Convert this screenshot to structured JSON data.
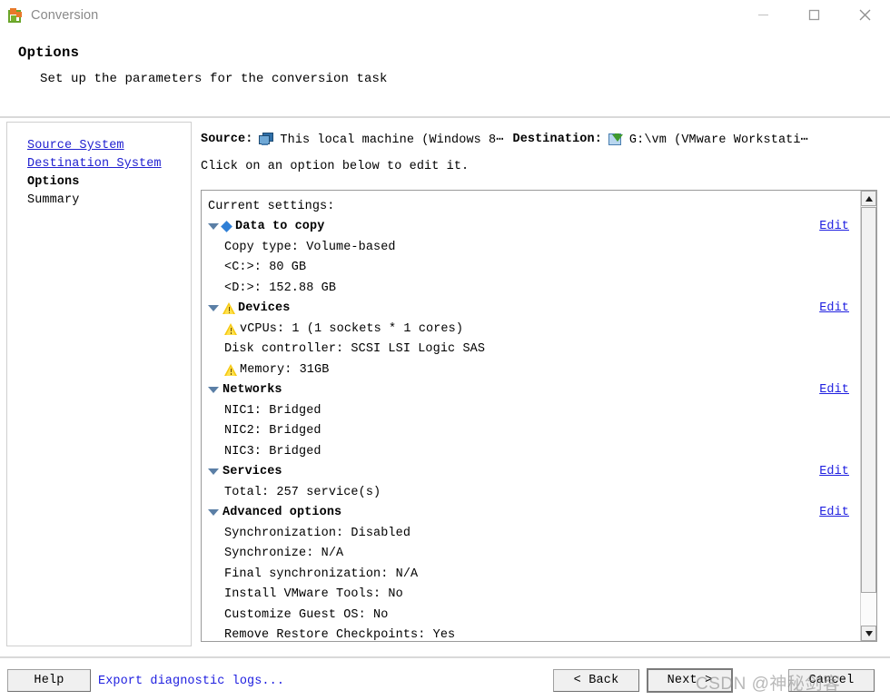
{
  "window": {
    "title": "Conversion",
    "icon": "vmware-converter-icon",
    "controls": {
      "minimize": "minimize-icon",
      "maximize": "maximize-icon",
      "close": "close-icon"
    }
  },
  "header": {
    "title": "Options",
    "subtitle": "Set up the parameters for the conversion task"
  },
  "sidebar": {
    "items": [
      {
        "label": "Source System",
        "type": "link"
      },
      {
        "label": "Destination System",
        "type": "link"
      },
      {
        "label": "Options",
        "type": "current"
      },
      {
        "label": "Summary",
        "type": "plain"
      }
    ]
  },
  "summary_bar": {
    "source_label": "Source:",
    "source_icon": "monitor-icon",
    "source_value": "This local machine (Windows 8⋯",
    "destination_label": "Destination:",
    "destination_icon": "import-arrow-icon",
    "destination_value": "G:\\vm (VMware Workstati⋯"
  },
  "instruction": "Click on an option below to edit it.",
  "settings": {
    "caption": "Current settings:",
    "edit_label": "Edit",
    "groups": [
      {
        "name": "Data to copy",
        "icon": "blue-diamond-icon",
        "expanded": true,
        "edit": true,
        "rows": [
          {
            "text": "Copy type: Volume-based",
            "icon": null
          },
          {
            "text": "<C:>: 80 GB",
            "icon": null
          },
          {
            "text": "<D:>: 152.88 GB",
            "icon": null
          }
        ]
      },
      {
        "name": "Devices",
        "icon": "warning-icon",
        "expanded": true,
        "edit": true,
        "rows": [
          {
            "text": "vCPUs: 1 (1 sockets * 1 cores)",
            "icon": "warning-icon"
          },
          {
            "text": "Disk controller: SCSI LSI Logic SAS",
            "icon": null
          },
          {
            "text": "Memory: 31GB",
            "icon": "warning-icon"
          }
        ]
      },
      {
        "name": "Networks",
        "icon": null,
        "expanded": true,
        "edit": true,
        "rows": [
          {
            "text": "NIC1: Bridged",
            "icon": null
          },
          {
            "text": "NIC2: Bridged",
            "icon": null
          },
          {
            "text": "NIC3: Bridged",
            "icon": null
          }
        ]
      },
      {
        "name": "Services",
        "icon": null,
        "expanded": true,
        "edit": true,
        "rows": [
          {
            "text": "Total: 257 service(s)",
            "icon": null
          }
        ]
      },
      {
        "name": "Advanced options",
        "icon": null,
        "expanded": true,
        "edit": true,
        "rows": [
          {
            "text": "Synchronization: Disabled",
            "icon": null
          },
          {
            "text": "Synchronize: N/A",
            "icon": null
          },
          {
            "text": "Final synchronization: N/A",
            "icon": null
          },
          {
            "text": "Install VMware Tools: No",
            "icon": null
          },
          {
            "text": "Customize Guest OS: No",
            "icon": null
          },
          {
            "text": "Remove Restore Checkpoints: Yes",
            "icon": null
          }
        ]
      }
    ]
  },
  "scrollbar": {
    "up_icon": "scroll-up-arrow-icon",
    "down_icon": "scroll-down-arrow-icon"
  },
  "footer": {
    "help": "Help",
    "export_logs": "Export diagnostic logs...",
    "back": "< Back",
    "next": "Next >",
    "cancel": "Cancel"
  },
  "watermark": "CSDN @神秘剑客",
  "colors": {
    "link": "#2020e0",
    "warning": "#f6c915",
    "diamond": "#2f7fd6",
    "title_text": "#8a8a8a"
  }
}
